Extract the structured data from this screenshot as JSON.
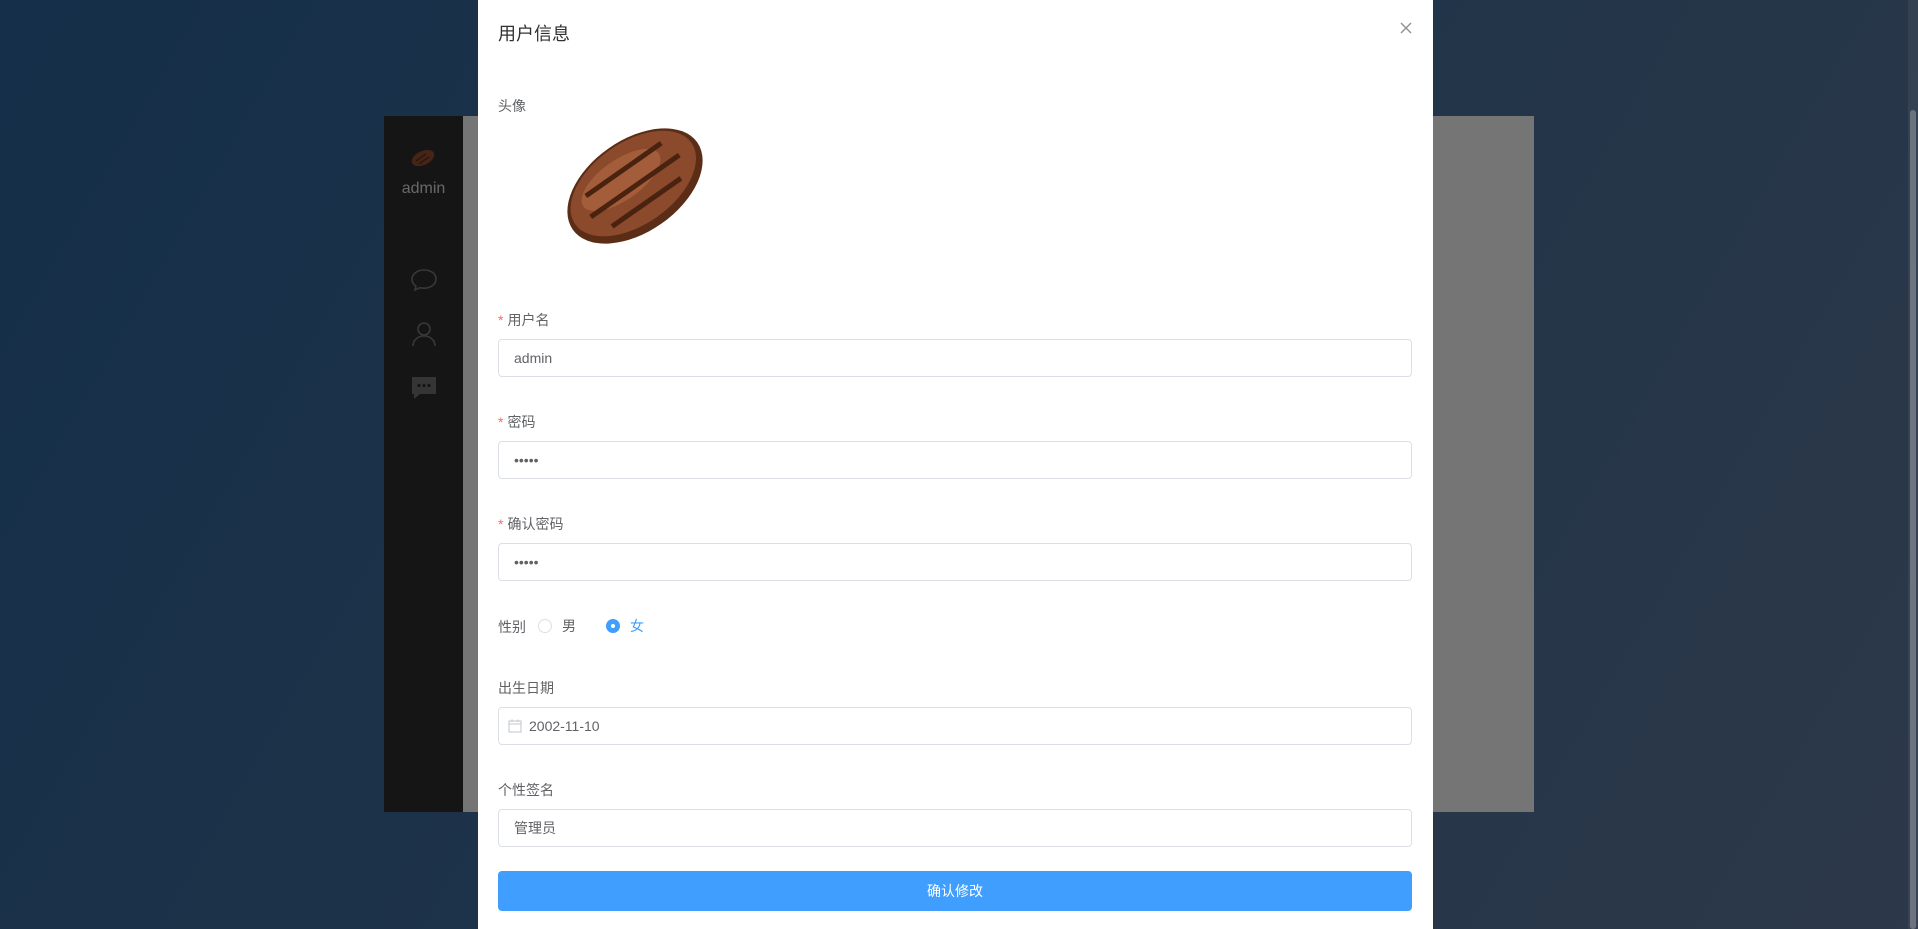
{
  "app": {
    "username": "admin",
    "nav_icons": [
      "chat-bubble-icon",
      "user-icon",
      "message-icon"
    ]
  },
  "dialog": {
    "title": "用户信息",
    "close_icon": "close-icon",
    "avatar_label": "头像",
    "username_label": "用户名",
    "username_value": "admin",
    "password_label": "密码",
    "password_value": "•••••",
    "confirm_password_label": "确认密码",
    "confirm_password_value": "•••••",
    "gender_label": "性别",
    "gender_options": [
      "男",
      "女"
    ],
    "gender_selected": "女",
    "birthday_label": "出生日期",
    "birthday_value": "2002-11-10",
    "signature_label": "个性签名",
    "signature_value": "管理员",
    "submit_label": "确认修改"
  },
  "colors": {
    "primary": "#409eff",
    "required": "#f56c6c",
    "sidebar": "#2a2a2a"
  }
}
